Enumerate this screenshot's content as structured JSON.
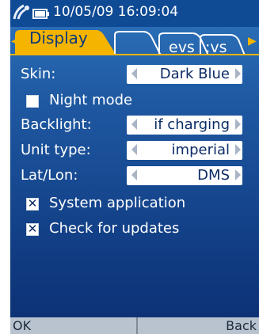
{
  "status": {
    "datetime": "10/05/09 16:09:04",
    "icons": [
      "satellite-icon",
      "battery-icon"
    ]
  },
  "tabs": {
    "active": "Display",
    "ghost_1": "evs",
    "ghost_2": ":vs",
    "left_arrow": "◀",
    "right_arrow": "▶"
  },
  "settings": {
    "skin": {
      "label": "Skin:",
      "value": "Dark Blue"
    },
    "night_mode": {
      "label": "Night mode",
      "checked": false
    },
    "backlight": {
      "label": "Backlight:",
      "value": "if charging"
    },
    "unit_type": {
      "label": "Unit type:",
      "value": "imperial"
    },
    "latlon": {
      "label": "Lat/Lon:",
      "value": "DMS"
    },
    "system_application": {
      "label": "System application",
      "checked": true,
      "mark": "✕"
    },
    "check_updates": {
      "label": "Check for updates",
      "checked": true,
      "mark": "✕"
    }
  },
  "softkeys": {
    "left": "OK",
    "right": "Back"
  },
  "colors": {
    "accent": "#f5b400",
    "background": "#1f5aa3",
    "softbar": "#b9c3cf"
  }
}
